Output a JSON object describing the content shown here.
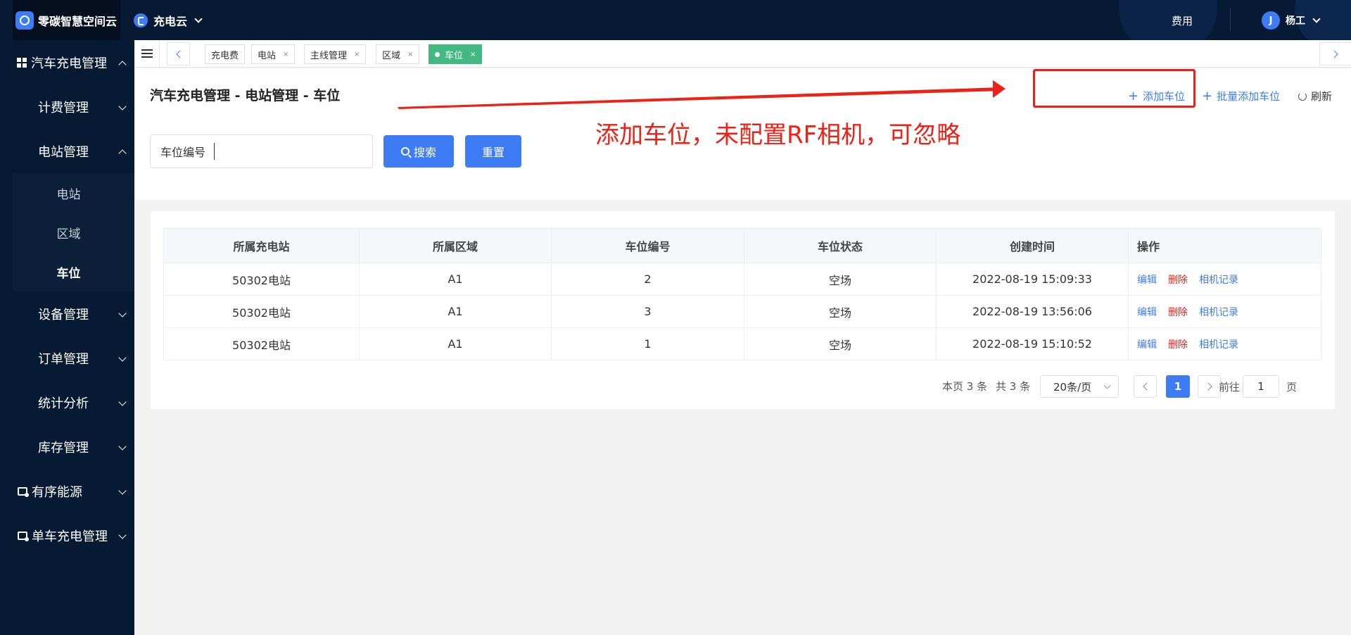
{
  "topbar": {
    "brand": "零碳智慧空间云",
    "app_name": "充电云",
    "fee_label": "费用",
    "user_name": "杨工",
    "avatar_glyph": "J"
  },
  "sidebar": {
    "groups": [
      {
        "label": "汽车充电管理",
        "icon": "grid-icon",
        "expanded": true
      },
      {
        "label": "有序能源",
        "icon": "picture-icon",
        "expanded": false
      },
      {
        "label": "单车充电管理",
        "icon": "picture-icon",
        "expanded": false
      }
    ],
    "items": [
      {
        "label": "计费管理"
      },
      {
        "label": "电站管理",
        "expanded": true
      },
      {
        "label": "设备管理"
      },
      {
        "label": "订单管理"
      },
      {
        "label": "统计分析"
      },
      {
        "label": "库存管理"
      }
    ],
    "subitems": [
      {
        "label": "电站"
      },
      {
        "label": "区域"
      },
      {
        "label": "车位",
        "active": true
      }
    ]
  },
  "tabs": [
    {
      "label": "充电费",
      "closable": false
    },
    {
      "label": "电站",
      "close": "×"
    },
    {
      "label": "主线管理",
      "close": "×"
    },
    {
      "label": "区域",
      "close": "×"
    },
    {
      "label": "车位",
      "close": "×",
      "active": true
    }
  ],
  "header": {
    "title": "汽车充电管理 - 电站管理 - 车位",
    "add_label": "添加车位",
    "batch_add_label": "批量添加车位",
    "refresh_label": "刷新",
    "plus_glyph": "+"
  },
  "annotation": {
    "text": "添加车位，未配置RF相机，可忽略",
    "color": "#ec2216"
  },
  "search": {
    "label": "车位编号",
    "search_button": "搜索",
    "reset_button": "重置"
  },
  "table": {
    "columns": [
      "所属充电站",
      "所属区域",
      "车位编号",
      "车位状态",
      "创建时间",
      "操作"
    ],
    "rows": [
      {
        "station": "50302电站",
        "area": "A1",
        "number": "2",
        "status": "空场",
        "created": "2022-08-19 15:09:33"
      },
      {
        "station": "50302电站",
        "area": "A1",
        "number": "3",
        "status": "空场",
        "created": "2022-08-19 13:56:06"
      },
      {
        "station": "50302电站",
        "area": "A1",
        "number": "1",
        "status": "空场",
        "created": "2022-08-19 15:10:52"
      }
    ],
    "actions": {
      "edit": "编辑",
      "delete": "删除",
      "camera": "相机记录"
    }
  },
  "pagination": {
    "page_count_text": "本页 3 条",
    "total_text": "共 3 条",
    "page_size": "20条/页",
    "current_page": "1",
    "goto_label": "前往",
    "goto_value": "1",
    "page_suffix": "页"
  },
  "colors": {
    "primary": "#3d7cf5",
    "nav_bg": "#071a33",
    "tab_active": "#42b983",
    "danger": "#e8211b"
  }
}
